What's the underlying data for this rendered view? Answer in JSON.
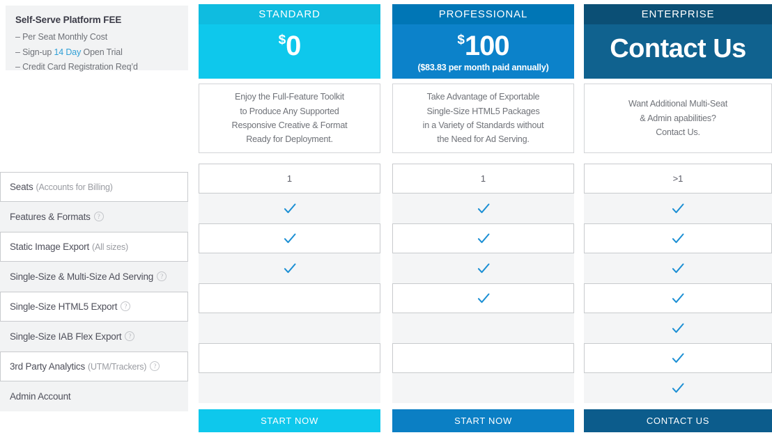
{
  "promo": {
    "title": "Self-Serve Platform FEE",
    "lines": [
      {
        "prefix": "– Per Seat Monthly Cost",
        "highlight": "",
        "suffix": ""
      },
      {
        "prefix": "– Sign-up ",
        "highlight": "14 Day",
        "suffix": " Open Trial"
      },
      {
        "prefix": "– Credit Card Registration Req’d",
        "highlight": "",
        "suffix": ""
      }
    ],
    "line1": "– Per Seat Monthly Cost",
    "line2_pre": "– Sign-up ",
    "line2_hl": "14 Day",
    "line2_post": " Open Trial",
    "line3": "– Credit Card Registration Req’d"
  },
  "features": [
    {
      "label": "Seats",
      "note": "(Accounts for Billing)",
      "help": false,
      "style": "boxed"
    },
    {
      "label": "Features & Formats",
      "note": "",
      "help": true,
      "style": "shaded"
    },
    {
      "label": "Static Image Export",
      "note": "(All sizes)",
      "help": false,
      "style": "boxed"
    },
    {
      "label": "Single-Size & Multi-Size Ad Serving",
      "note": "",
      "help": true,
      "style": "shaded"
    },
    {
      "label": "Single-Size HTML5 Export",
      "note": "",
      "help": true,
      "style": "boxed"
    },
    {
      "label": "Single-Size IAB Flex Export",
      "note": "",
      "help": true,
      "style": "shaded"
    },
    {
      "label": "3rd Party Analytics",
      "note": "(UTM/Trackers)",
      "help": true,
      "style": "boxed"
    },
    {
      "label": "Admin Account",
      "note": "",
      "help": false,
      "style": "shaded"
    }
  ],
  "help_icon": "?",
  "check_icon": "check-icon",
  "plans": [
    {
      "name": "STANDARD",
      "currency": "$",
      "price": "0",
      "sub_price": "",
      "description": "Enjoy the Full-Feature Toolkit\nto Produce Any Supported\nResponsive Creative & Format\nReady for Deployment.",
      "cta": "START NOW",
      "color_strip": "#0fbce0",
      "color_body": "#0ec8ec",
      "color_cta": "#0ec8ec",
      "values": [
        "1",
        "check",
        "check",
        "check",
        "",
        "",
        "",
        ""
      ]
    },
    {
      "name": "PROFESSIONAL",
      "currency": "$",
      "price": "100",
      "sub_price": "($83.83 per month paid annually)",
      "description": "Take Advantage of Exportable\nSingle-Size HTML5 Packages\nin a Variety of Standards without\nthe Need for Ad Serving.",
      "cta": "START NOW",
      "color_strip": "#0076b6",
      "color_body": "#0c82ca",
      "color_cta": "#0b7fc4",
      "values": [
        "1",
        "check",
        "check",
        "check",
        "check",
        "",
        "",
        ""
      ]
    },
    {
      "name": "ENTERPRISE",
      "currency": "",
      "price": "Contact Us",
      "sub_price": "",
      "description": "Want Additional Multi-Seat\n& Admin apabilities?\nContact Us.",
      "cta": "CONTACT US",
      "color_strip": "#0b4f75",
      "color_body": "#10628f",
      "color_cta": "#0c5c8c",
      "values": [
        ">1",
        "check",
        "check",
        "check",
        "check",
        "check",
        "check",
        "check"
      ]
    }
  ],
  "colors": {
    "check": "#1b8fd4",
    "row_shaded": "#f4f5f6",
    "row_border": "#c8cacd",
    "sidebar_box": "#f2f3f4",
    "link_blue": "#2f9fd6"
  }
}
